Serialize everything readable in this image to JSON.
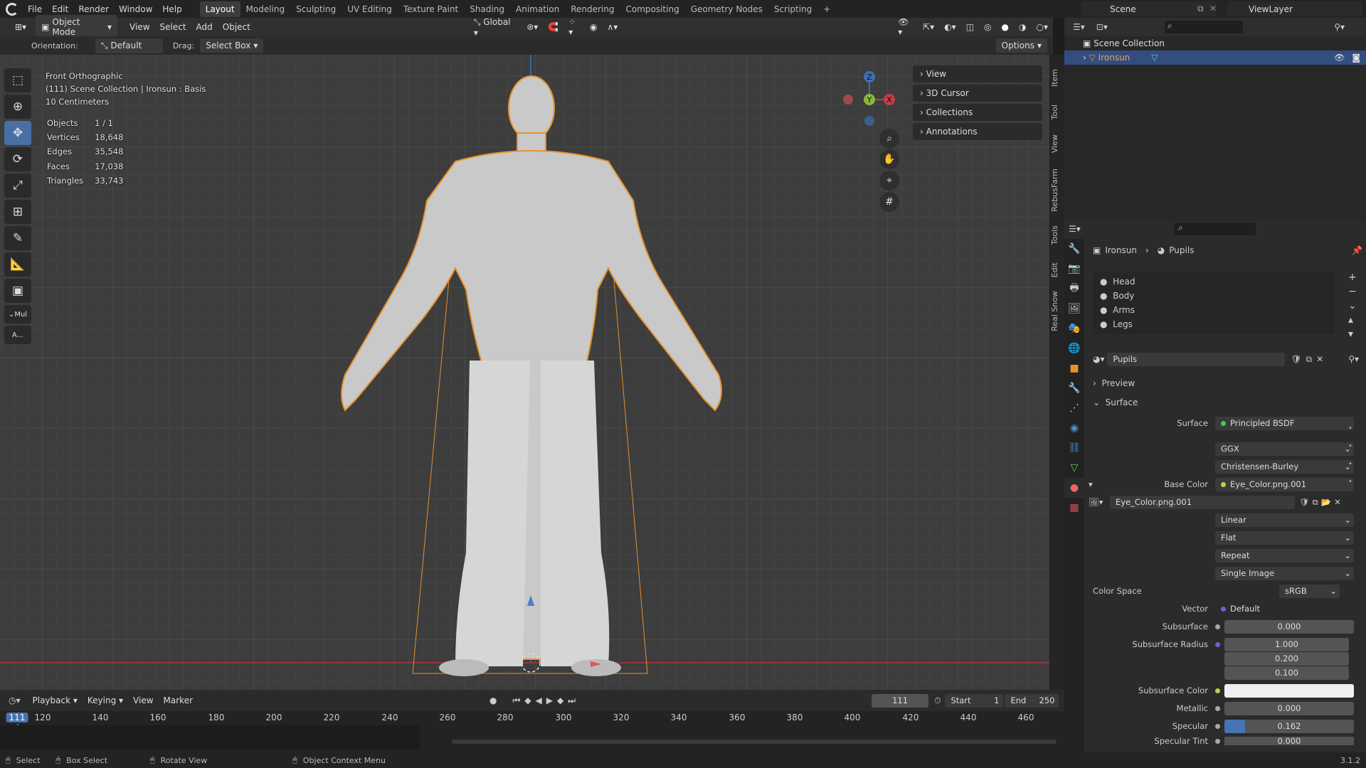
{
  "topbar": {
    "menu": [
      "File",
      "Edit",
      "Render",
      "Window",
      "Help"
    ],
    "workspaces": [
      "Layout",
      "Modeling",
      "Sculpting",
      "UV Editing",
      "Texture Paint",
      "Shading",
      "Animation",
      "Rendering",
      "Compositing",
      "Geometry Nodes",
      "Scripting"
    ],
    "active_workspace": "Layout",
    "add_tab": "+",
    "scene": "Scene",
    "view_layer": "ViewLayer"
  },
  "viewport_header": {
    "mode": "Object Mode",
    "menus": [
      "View",
      "Select",
      "Add",
      "Object"
    ],
    "transform": "Global"
  },
  "tool_settings": {
    "orientation_label": "Orientation:",
    "orientation": "Default",
    "drag_label": "Drag:",
    "drag": "Select Box",
    "options": "Options"
  },
  "viewport": {
    "view_name": "Front Orthographic",
    "collection_info": "(111) Scene Collection | Ironsun : Basis",
    "scale": "10 Centimeters",
    "stats": [
      {
        "label": "Objects",
        "value": "1 / 1"
      },
      {
        "label": "Vertices",
        "value": "18,648"
      },
      {
        "label": "Edges",
        "value": "35,548"
      },
      {
        "label": "Faces",
        "value": "17,038"
      },
      {
        "label": "Triangles",
        "value": "33,743"
      }
    ],
    "npanel": [
      "View",
      "3D Cursor",
      "Collections",
      "Annotations"
    ],
    "side_tabs": [
      "Item",
      "Tool",
      "View",
      "RebusFarm",
      "Tools",
      "Edit",
      "Real Snow"
    ],
    "gizmo": {
      "z": "Z",
      "y": "Y",
      "x": "X"
    },
    "toolbar_extra": [
      "Mul",
      "A..."
    ]
  },
  "outliner": {
    "root": "Scene Collection",
    "object": "Ironsun"
  },
  "properties": {
    "breadcrumb_object": "Ironsun",
    "breadcrumb_material": "Pupils",
    "material_slots": [
      "Head",
      "Body",
      "Arms",
      "Legs"
    ],
    "material_name": "Pupils",
    "sections": {
      "preview": "Preview",
      "surface": "Surface"
    },
    "rows": [
      {
        "label": "Surface",
        "value": "Principled BSDF"
      },
      {
        "label": "",
        "value": "GGX"
      },
      {
        "label": "",
        "value": "Christensen-Burley"
      },
      {
        "label": "Base Color",
        "value": "Eye_Color.png.001"
      },
      {
        "label": "",
        "value": "Eye_Color.png.001"
      },
      {
        "label": "",
        "value": "Linear"
      },
      {
        "label": "",
        "value": "Flat"
      },
      {
        "label": "",
        "value": "Repeat"
      },
      {
        "label": "",
        "value": "Single Image"
      },
      {
        "label": "Color Space",
        "value": "sRGB"
      },
      {
        "label": "Vector",
        "value": "Default"
      },
      {
        "label": "Subsurface",
        "value": "0.000"
      },
      {
        "label": "Subsurface Radius",
        "value": "1.000"
      },
      {
        "label": "",
        "value": "0.200"
      },
      {
        "label": "",
        "value": "0.100"
      },
      {
        "label": "Subsurface Color",
        "value": ""
      },
      {
        "label": "Metallic",
        "value": "0.000"
      },
      {
        "label": "Specular",
        "value": "0.162"
      },
      {
        "label": "Specular Tint",
        "value": "0.000"
      }
    ],
    "specular_fill": 0.162
  },
  "timeline": {
    "menus": [
      "Playback",
      "Keying",
      "View",
      "Marker"
    ],
    "current_frame": "111",
    "start_label": "Start",
    "start": "1",
    "end_label": "End",
    "end": "250",
    "frame_labels": [
      "120",
      "140",
      "160",
      "180",
      "200",
      "220",
      "240",
      "260",
      "280",
      "300",
      "320",
      "340",
      "360",
      "380",
      "400",
      "420",
      "440",
      "460"
    ]
  },
  "statusbar": {
    "select": "Select",
    "box_select": "Box Select",
    "rotate": "Rotate View",
    "context": "Object Context Menu",
    "version": "3.1.2"
  }
}
